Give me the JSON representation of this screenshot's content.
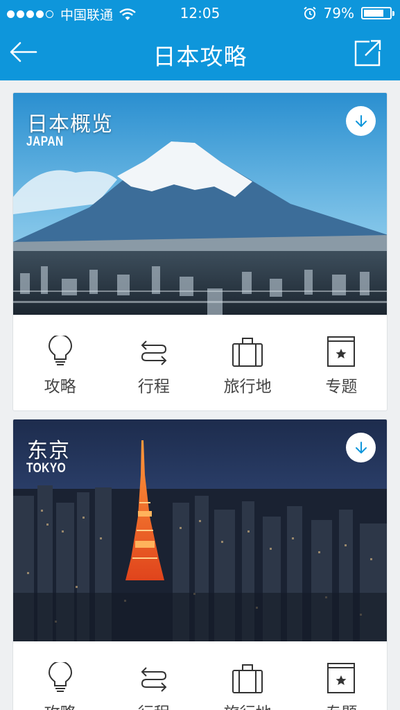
{
  "status": {
    "carrier": "中国联通",
    "time": "12:05",
    "battery": "79%",
    "battery_level": 0.79
  },
  "navbar": {
    "title": "日本攻略",
    "back_icon": "back-arrow-icon",
    "share_icon": "share-icon"
  },
  "cards": [
    {
      "title": "日本概览",
      "subtitle": "JAPAN",
      "actions": [
        "攻略",
        "行程",
        "旅行地",
        "专题"
      ]
    },
    {
      "title": "东京",
      "subtitle": "TOKYO",
      "actions": [
        "攻略",
        "行程",
        "旅行地",
        "专题"
      ]
    }
  ],
  "colors": {
    "accent": "#0e96db",
    "icon": "#333333"
  }
}
